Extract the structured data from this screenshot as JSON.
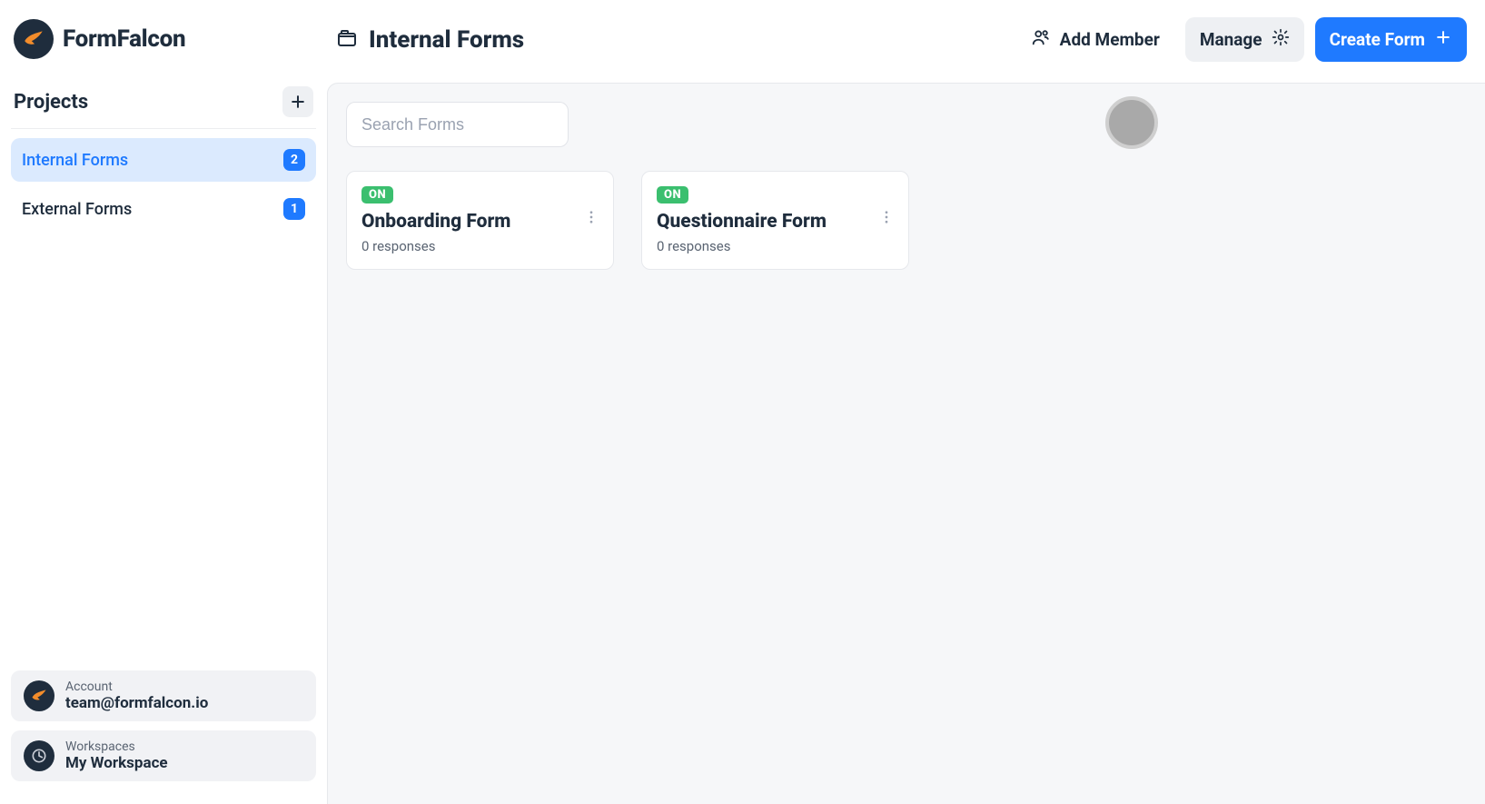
{
  "brand": {
    "name": "FormFalcon"
  },
  "sidebar": {
    "projects_label": "Projects",
    "items": [
      {
        "name": "Internal Forms",
        "count": "2",
        "active": true
      },
      {
        "name": "External Forms",
        "count": "1",
        "active": false
      }
    ],
    "account": {
      "label": "Account",
      "value": "team@formfalcon.io"
    },
    "workspace": {
      "label": "Workspaces",
      "value": "My Workspace"
    }
  },
  "header": {
    "title": "Internal Forms",
    "add_member_label": "Add Member",
    "manage_label": "Manage",
    "create_form_label": "Create Form"
  },
  "search": {
    "placeholder": "Search Forms",
    "value": ""
  },
  "forms": [
    {
      "status": "ON",
      "title": "Onboarding Form",
      "subtitle": "0 responses"
    },
    {
      "status": "ON",
      "title": "Questionnaire Form",
      "subtitle": "0 responses"
    }
  ]
}
